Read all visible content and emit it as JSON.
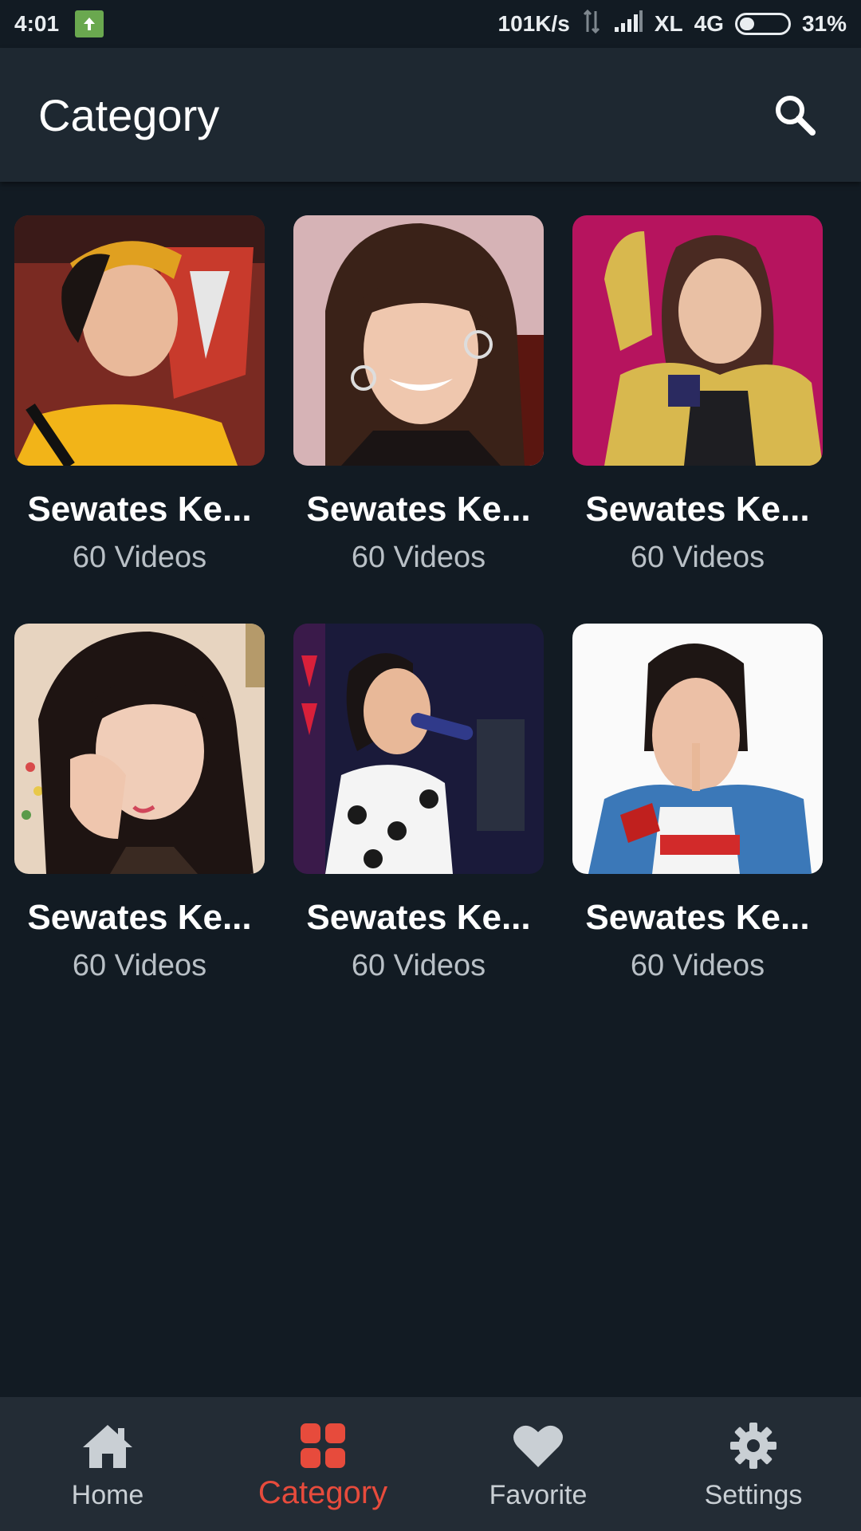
{
  "status_bar": {
    "time": "4:01",
    "network_speed": "101K/s",
    "carrier": "XL",
    "network_type": "4G",
    "battery": "31%",
    "battery_level": 0.31
  },
  "app_bar": {
    "title": "Category",
    "search_icon": "search-icon"
  },
  "categories": [
    {
      "title": "Sewates Ke...",
      "count": "60 Videos"
    },
    {
      "title": "Sewates Ke...",
      "count": "60 Videos"
    },
    {
      "title": "Sewates Ke...",
      "count": "60 Videos"
    },
    {
      "title": "Sewates Ke...",
      "count": "60 Videos"
    },
    {
      "title": "Sewates Ke...",
      "count": "60 Videos"
    },
    {
      "title": "Sewates Ke...",
      "count": "60 Videos"
    }
  ],
  "bottom_nav": {
    "items": [
      {
        "label": "Home",
        "icon": "home-icon"
      },
      {
        "label": "Category",
        "icon": "grid-icon"
      },
      {
        "label": "Favorite",
        "icon": "heart-icon"
      },
      {
        "label": "Settings",
        "icon": "gear-icon"
      }
    ],
    "active_index": 1
  },
  "colors": {
    "background": "#121b23",
    "app_bar": "#1e2831",
    "bottom_nav": "#232c35",
    "accent": "#e74b3c",
    "muted_text": "#b9c0c6"
  }
}
